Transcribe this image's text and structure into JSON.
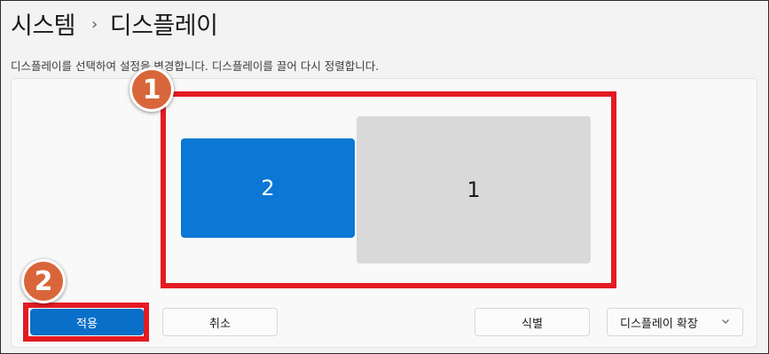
{
  "header": {
    "breadcrumb_parent": "시스템",
    "breadcrumb_separator_icon": "chevron-right-icon",
    "breadcrumb_current": "디스플레이"
  },
  "arrangement": {
    "instruction": "디스플레이를 선택하여 설정을 변경합니다. 디스플레이를 끌어 다시 정렬합니다.",
    "monitors": [
      {
        "number": "2",
        "selected": true,
        "color": "#0a78d4"
      },
      {
        "number": "1",
        "selected": false,
        "color": "#d9d9d9"
      }
    ]
  },
  "buttons": {
    "apply_label": "적용",
    "cancel_label": "취소",
    "identify_label": "식별",
    "apply_color": "#0a6fc8"
  },
  "display_mode": {
    "selected": "디스플레이 확장",
    "icon": "chevron-down-icon"
  },
  "annotations": {
    "badge_1": "1",
    "badge_2": "2",
    "highlight_color": "#e31b23",
    "badge_color": "#d9663a"
  }
}
